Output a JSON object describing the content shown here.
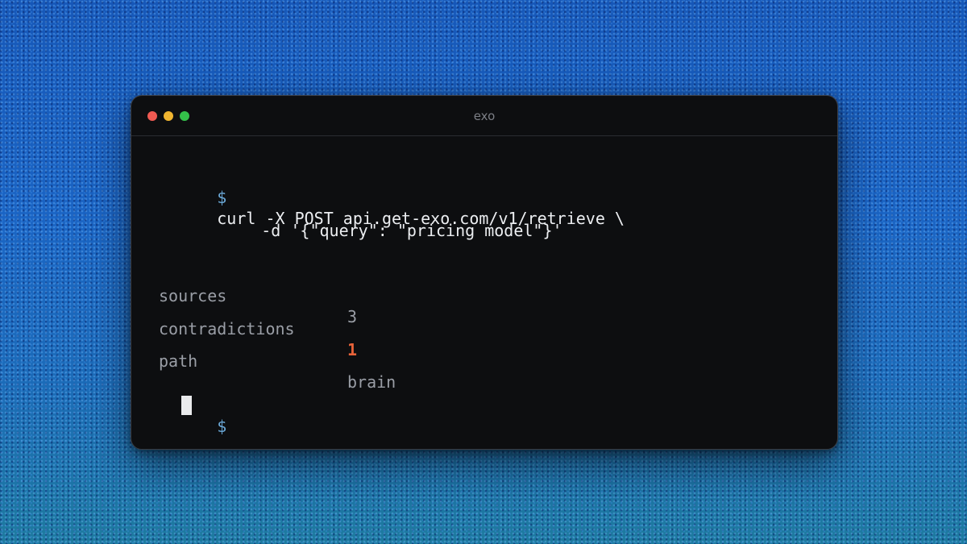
{
  "window": {
    "title": "exo"
  },
  "command": {
    "prompt": "$",
    "line1": "curl -X POST api.get-exo.com/v1/retrieve \\",
    "line2": "-d '{\"query\": \"pricing model\"}'"
  },
  "results": [
    {
      "key": "sources",
      "value": "3"
    },
    {
      "key": "contradictions",
      "value": "1"
    },
    {
      "key": "path",
      "value": "brain"
    }
  ],
  "final_prompt": "$",
  "colors": {
    "prompt": "#6aa7d6",
    "warning_value": "#e8633a",
    "window_bg": "#0d0e10"
  }
}
